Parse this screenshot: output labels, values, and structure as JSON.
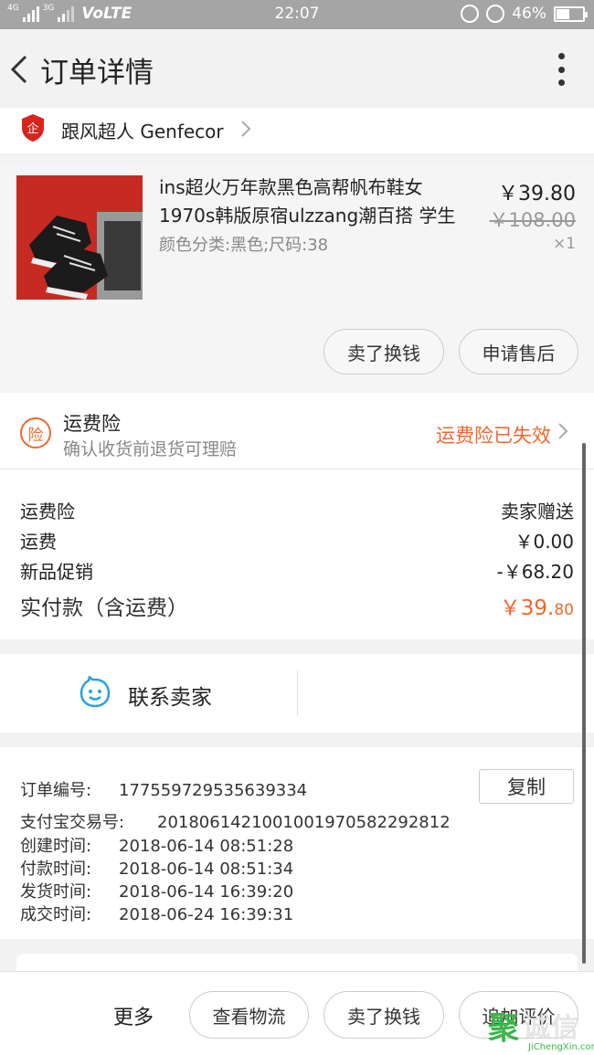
{
  "status_bar": {
    "net1": "4G",
    "net2": "3G",
    "volte": "VoLTE",
    "time": "22:07",
    "battery": "46%",
    "battery_level": 0.46
  },
  "header": {
    "title": "订单详情"
  },
  "shop": {
    "name": "跟风超人 Genfecor",
    "badge_text": "企"
  },
  "product": {
    "title": "ins超火万年款黑色高帮帆布鞋女1970s韩版原宿ulzzang潮百搭 学生",
    "sku": "颜色分类:黑色;尺码:38",
    "price": "￥39.80",
    "original_price": "￥108.00",
    "quantity": "×1",
    "buttons": {
      "sell": "卖了换钱",
      "after_sale": "申请售后"
    }
  },
  "insurance": {
    "icon_text": "险",
    "title": "运费险",
    "subtitle": "确认收货前退货可理赔",
    "status": "运费险已失效"
  },
  "fees": [
    {
      "label": "运费险",
      "value": "卖家赠送"
    },
    {
      "label": "运费",
      "value": "￥0.00"
    },
    {
      "label": "新品促销",
      "value": "-￥68.20"
    }
  ],
  "total": {
    "label": "实付款（含运费）",
    "value_main": "￥39.",
    "value_cents": "80"
  },
  "contact": {
    "label": "联系卖家"
  },
  "order_info": {
    "order_no_label": "订单编号:",
    "order_no": "177559729535639334",
    "copy_label": "复制",
    "alipay_label": "支付宝交易号:",
    "alipay_no": "2018061421001001970582292812",
    "created_label": "创建时间:",
    "created": "2018-06-14 08:51:28",
    "paid_label": "付款时间:",
    "paid": "2018-06-14 08:51:34",
    "shipped_label": "发货时间:",
    "shipped": "2018-06-14 16:39:20",
    "deal_label": "成交时间:",
    "deal": "2018-06-24 16:39:31"
  },
  "bottom_bar": {
    "more": "更多",
    "logistics": "查看物流",
    "sell": "卖了换钱",
    "review": "追加评价"
  },
  "watermark": {
    "logo": "聚",
    "name": "诚信",
    "url": "JiChengXin.com"
  },
  "colors": {
    "accent": "#f2672b",
    "badge_red": "#d9231d",
    "contact_blue": "#2aa0e6",
    "status_bar": "#a5a5a5"
  }
}
